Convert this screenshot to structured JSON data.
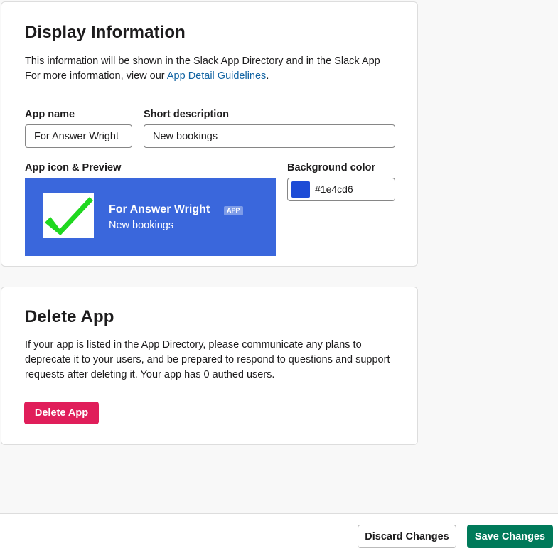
{
  "display_info": {
    "title": "Display Information",
    "description_line1": "This information will be shown in the Slack App Directory and in the Slack App",
    "more_info_prefix": "For more information, view our ",
    "more_info_link": "App Detail Guidelines",
    "more_info_suffix": ".",
    "app_name_label": "App name",
    "app_name_value": "For Answer Wright",
    "short_desc_label": "Short description",
    "short_desc_value": "New bookings",
    "icon_preview_label": "App icon & Preview",
    "bg_color_label": "Background color",
    "bg_color_value": "#1e4cd6",
    "preview": {
      "app_name": "For Answer Wright",
      "badge": "APP",
      "description": "New bookings",
      "icon": "green-checkmark-icon",
      "background_color": "#3a67dc"
    }
  },
  "delete_app": {
    "title": "Delete App",
    "description": "If your app is listed in the App Directory, please communicate any plans to deprecate it to your users, and be prepared to respond to questions and support requests after deleting it. Your app has 0 authed users.",
    "button_label": "Delete App"
  },
  "footer": {
    "discard_label": "Discard Changes",
    "save_label": "Save Changes"
  },
  "colors": {
    "danger": "#e01e5a",
    "primary": "#007a5a",
    "link": "#1264a3",
    "swatch": "#1e4cd6"
  }
}
